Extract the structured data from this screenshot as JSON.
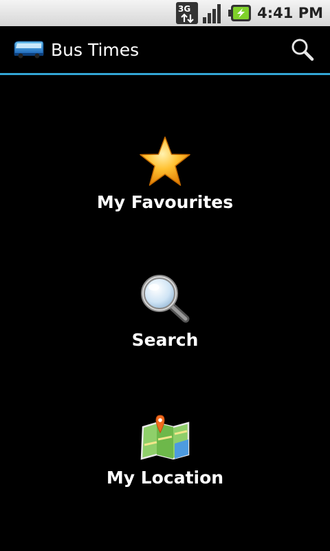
{
  "status_bar": {
    "network": "3G",
    "time": "4:41 PM",
    "icons": [
      "3g-data-icon",
      "signal-icon",
      "battery-charging-icon"
    ]
  },
  "action_bar": {
    "title": "Bus Times",
    "app_icon": "bus-icon",
    "action_icon": "search-icon",
    "accent_color": "#33a6d6"
  },
  "menu": {
    "items": [
      {
        "label": "My Favourites",
        "icon": "star-icon"
      },
      {
        "label": "Search",
        "icon": "magnifier-icon"
      },
      {
        "label": "My Location",
        "icon": "map-pin-icon"
      }
    ]
  }
}
